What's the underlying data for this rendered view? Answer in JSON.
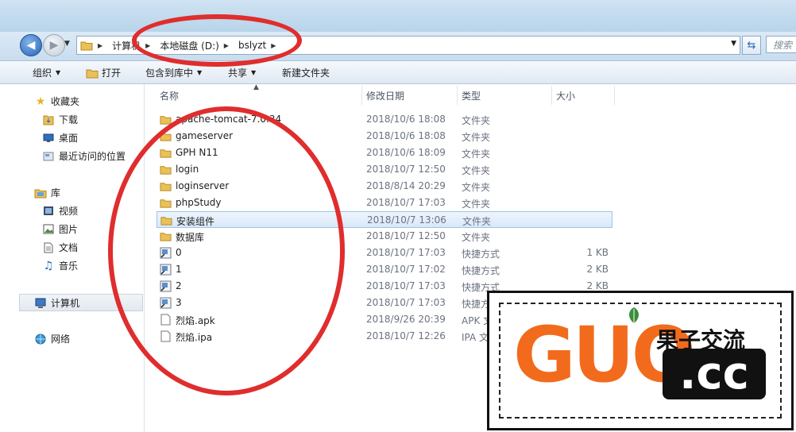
{
  "address": {
    "crumbs": [
      "计算机",
      "本地磁盘 (D:)",
      "bslyzt"
    ]
  },
  "search": {
    "placeholder": "搜索"
  },
  "toolbar": {
    "organize": "组织",
    "open": "打开",
    "include": "包含到库中",
    "share": "共享",
    "new_folder": "新建文件夹"
  },
  "sidebar": {
    "favorites": "收藏夹",
    "downloads": "下载",
    "desktop": "桌面",
    "recent": "最近访问的位置",
    "libraries": "库",
    "videos": "视频",
    "pictures": "图片",
    "documents": "文档",
    "music": "音乐",
    "computer": "计算机",
    "network": "网络"
  },
  "columns": {
    "name": "名称",
    "date": "修改日期",
    "type": "类型",
    "size": "大小"
  },
  "files": [
    {
      "name": "apache-tomcat-7.0.34",
      "date": "2018/10/6 18:08",
      "type": "文件夹",
      "size": "",
      "icon": "folder"
    },
    {
      "name": "gameserver",
      "date": "2018/10/6 18:08",
      "type": "文件夹",
      "size": "",
      "icon": "folder"
    },
    {
      "name": "GPH N11",
      "date": "2018/10/6 18:09",
      "type": "文件夹",
      "size": "",
      "icon": "folder"
    },
    {
      "name": "login",
      "date": "2018/10/7 12:50",
      "type": "文件夹",
      "size": "",
      "icon": "folder"
    },
    {
      "name": "loginserver",
      "date": "2018/8/14 20:29",
      "type": "文件夹",
      "size": "",
      "icon": "folder"
    },
    {
      "name": "phpStudy",
      "date": "2018/10/7 17:03",
      "type": "文件夹",
      "size": "",
      "icon": "folder"
    },
    {
      "name": "安装组件",
      "date": "2018/10/7 13:06",
      "type": "文件夹",
      "size": "",
      "icon": "folder"
    },
    {
      "name": "数据库",
      "date": "2018/10/7 12:50",
      "type": "文件夹",
      "size": "",
      "icon": "folder"
    },
    {
      "name": "0",
      "date": "2018/10/7 17:03",
      "type": "快捷方式",
      "size": "1 KB",
      "icon": "shortcut"
    },
    {
      "name": "1",
      "date": "2018/10/7 17:02",
      "type": "快捷方式",
      "size": "2 KB",
      "icon": "shortcut"
    },
    {
      "name": "2",
      "date": "2018/10/7 17:03",
      "type": "快捷方式",
      "size": "2 KB",
      "icon": "shortcut"
    },
    {
      "name": "3",
      "date": "2018/10/7 17:03",
      "type": "快捷方式",
      "size": "",
      "icon": "shortcut"
    },
    {
      "name": "烈焰.apk",
      "date": "2018/9/26 20:39",
      "type": "APK 文件",
      "size": "",
      "icon": "file"
    },
    {
      "name": "烈焰.ipa",
      "date": "2018/10/7 12:26",
      "type": "IPA 文件",
      "size": "",
      "icon": "file"
    }
  ],
  "selected_index": 6,
  "watermark": {
    "latin": "GUO",
    "cn": "果子交流",
    "tld": ".cc"
  },
  "colors": {
    "annotation": "#e02d2d",
    "accent": "#2b63b8",
    "logo_orange": "#f26b1d"
  }
}
